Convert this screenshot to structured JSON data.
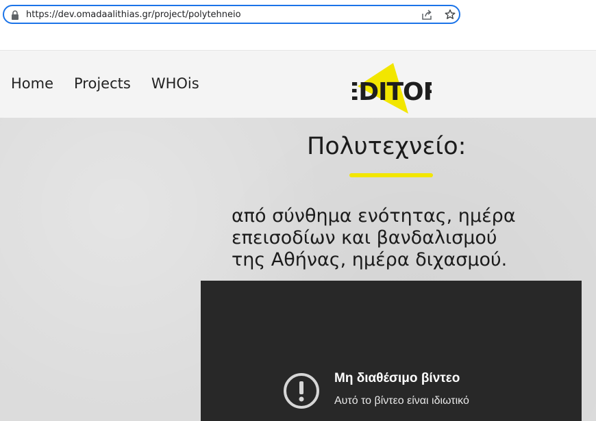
{
  "browser": {
    "url": "https://dev.omadaalithias.gr/project/polytehneio"
  },
  "nav": {
    "items": [
      "Home",
      "Projects",
      "WHOis"
    ]
  },
  "logo": {
    "text": "EDITOR",
    "accent_color": "#f2e600"
  },
  "article": {
    "title": "Πολυτεχνείο:",
    "subtitle_lines": [
      "από σύνθημα ενότητας, ημέρα",
      "επεισοδίων και βανδαλισμού",
      "της Αθήνας, ημέρα διχασμού."
    ]
  },
  "video": {
    "error_title": "Μη διαθέσιμο βίντεο",
    "error_message": "Αυτό το βίντεο είναι ιδιωτικό",
    "icon": "exclamation-circle-icon"
  }
}
